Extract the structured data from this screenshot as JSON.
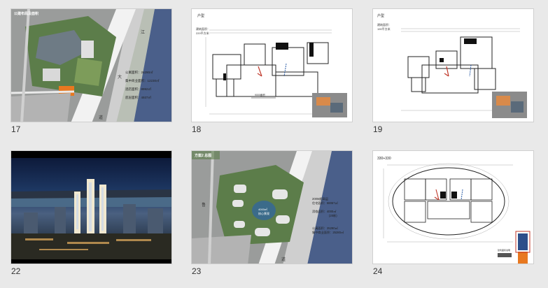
{
  "slides": [
    {
      "number": "17",
      "title": "公建布局及面积",
      "stats": [
        "公寓面积：26290㎡",
        "集中商业面积：12230㎡",
        "酒店面积：8992㎡",
        "底层面积：4937㎡"
      ],
      "road_labels": [
        "大",
        "道",
        "江"
      ]
    },
    {
      "number": "18",
      "heading": "户型",
      "subheading": [
        "建筑面积：",
        "220平方米"
      ],
      "dimension_note": "9000面积"
    },
    {
      "number": "19",
      "heading": "户型",
      "subheading": [
        "建筑面积：",
        "190平方米"
      ]
    },
    {
      "number": "22"
    },
    {
      "number": "23",
      "logo_text": "方案2 总图",
      "center_label": [
        "4000㎡",
        "核心景观"
      ],
      "stats": [
        "200M超高层",
        "住宅面积：68067㎡",
        "滨临面积：4000㎡",
        "(20栋)",
        "公寓面积：25290㎡",
        "集中商业面积：25280㎡"
      ],
      "road_labels": [
        "鲁",
        "道"
      ]
    },
    {
      "number": "24",
      "heading": "330+330",
      "legend_text": "建筑面积说明"
    }
  ],
  "colors": {
    "background": "#e9e9e9",
    "slide_border": "#cfcfcf",
    "aerial_green": "#5c7d4a",
    "river_blue": "#4a5f8a",
    "plan_red": "#c0392b",
    "plan_blue": "#2e5fa8",
    "orange_accent": "#e87820",
    "night_sky": "#0d1a3a"
  }
}
